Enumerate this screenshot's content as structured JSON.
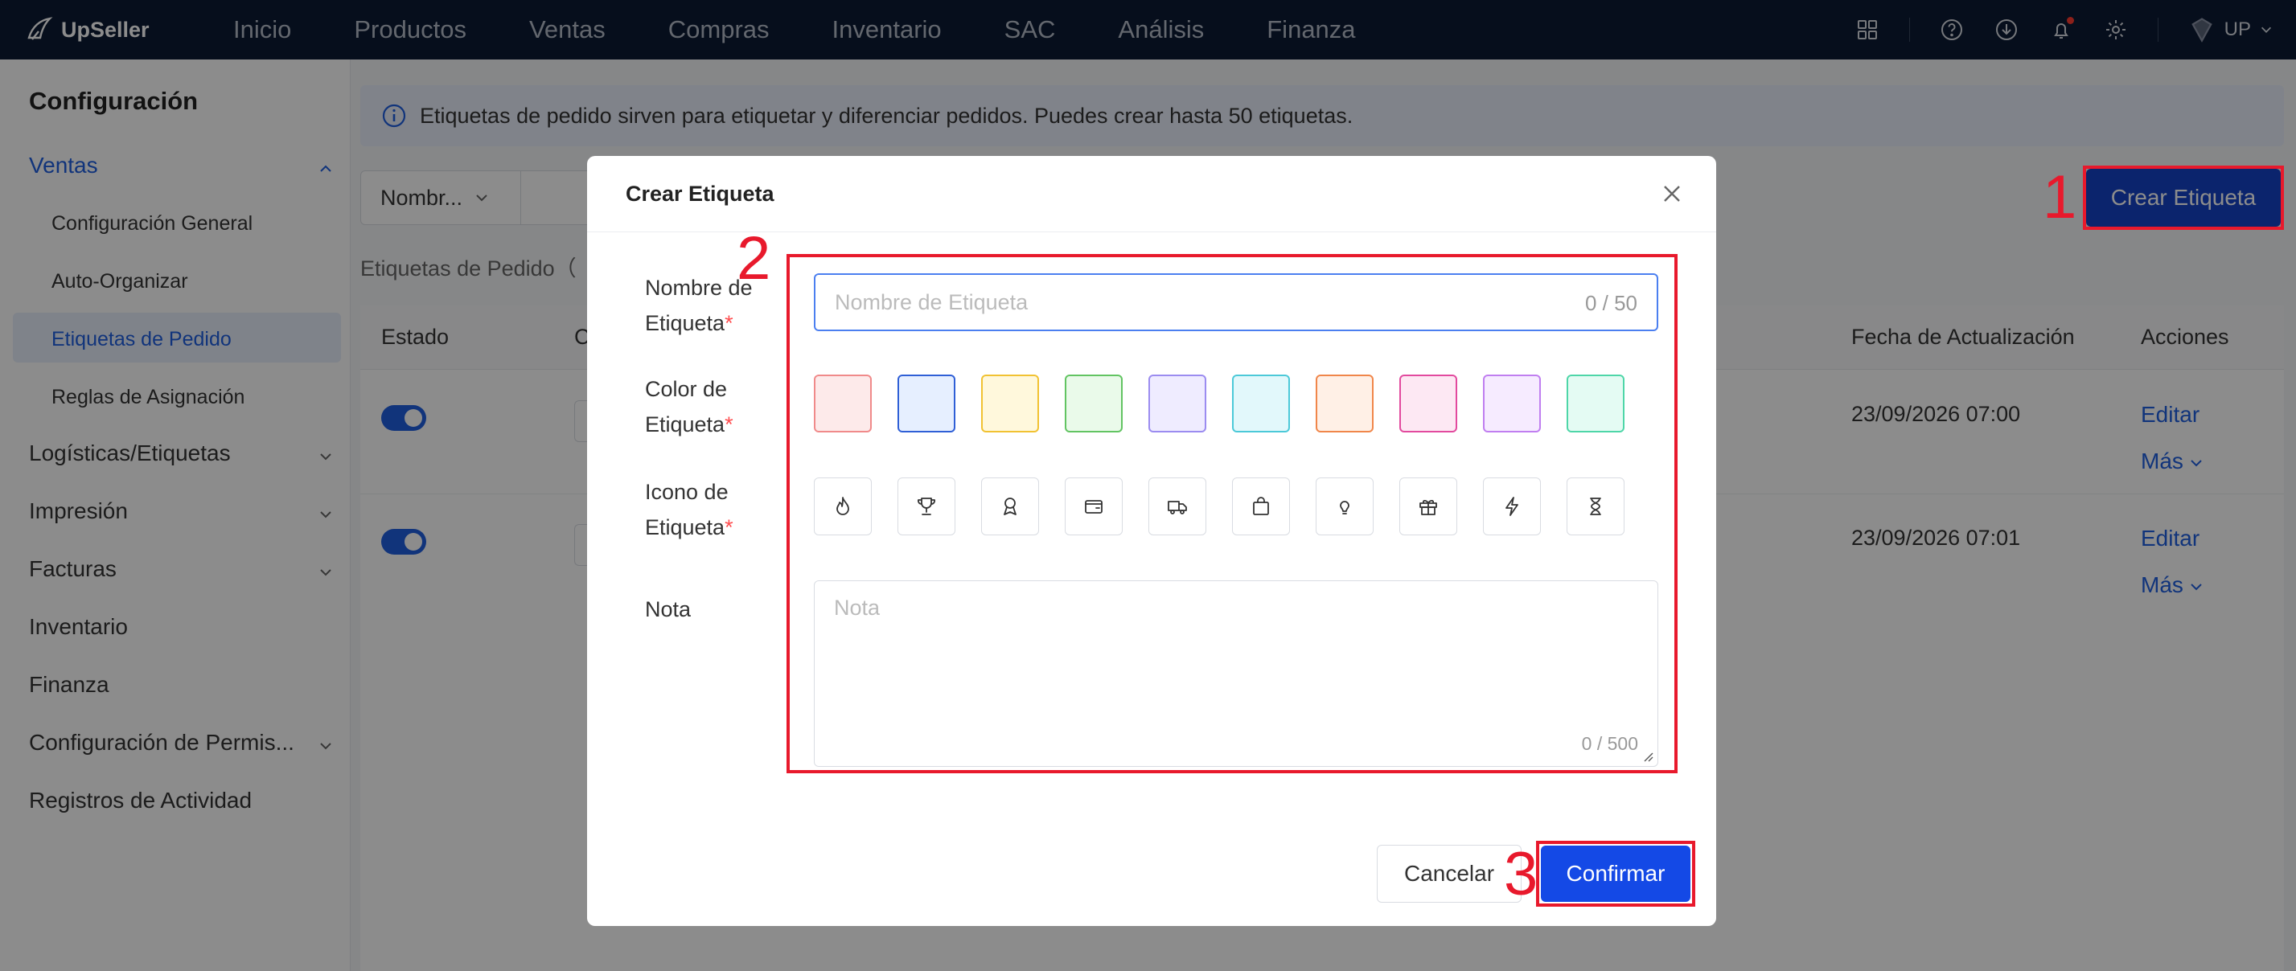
{
  "app": {
    "name": "UpSeller",
    "user": "UP"
  },
  "nav": [
    "Inicio",
    "Productos",
    "Ventas",
    "Compras",
    "Inventario",
    "SAC",
    "Análisis",
    "Finanza"
  ],
  "topbar_icons": [
    "apps-grid-icon",
    "help-icon",
    "download-icon",
    "bell-icon",
    "gear-icon",
    "avatar-icon",
    "chevron-down-icon"
  ],
  "sidebar": {
    "title": "Configuración",
    "ventas": "Ventas",
    "sub": [
      "Configuración General",
      "Auto-Organizar",
      "Etiquetas de Pedido",
      "Reglas de Asignación"
    ],
    "items": [
      "Logísticas/Etiquetas",
      "Impresión",
      "Facturas",
      "Inventario",
      "Finanza",
      "Configuración de Permis...",
      "Registros de Actividad"
    ]
  },
  "notice": "Etiquetas de pedido sirven para etiquetar y diferenciar pedidos. Puedes crear hasta 50 etiquetas.",
  "filter": {
    "select": "Nombr..."
  },
  "count_label": "Etiquetas de Pedido（",
  "create_button": "Crear Etiqueta",
  "table": {
    "headers": [
      "Estado",
      "C",
      "Fecha de Actualización",
      "Acciones"
    ],
    "rows": [
      {
        "date": "23/09/2026 07:00",
        "edit": "Editar",
        "more": "Más"
      },
      {
        "date": "23/09/2026 07:01",
        "edit": "Editar",
        "more": "Más"
      }
    ]
  },
  "modal": {
    "title": "Crear Etiqueta",
    "name_label": "Nombre de Etiqueta",
    "name_placeholder": "Nombre de Etiqueta",
    "name_count": "0 / 50",
    "color_label": "Color de Etiqueta",
    "colors": [
      {
        "bg": "#fdeaea",
        "border": "#f08a8a"
      },
      {
        "bg": "#e6efff",
        "border": "#2f5fd6"
      },
      {
        "bg": "#fff8dc",
        "border": "#f1c232"
      },
      {
        "bg": "#eafaea",
        "border": "#62c462"
      },
      {
        "bg": "#efecff",
        "border": "#9b8cf0"
      },
      {
        "bg": "#e2f8fb",
        "border": "#4cc9d8"
      },
      {
        "bg": "#fff0e6",
        "border": "#f0864a"
      },
      {
        "bg": "#fde8f3",
        "border": "#e24a9e"
      },
      {
        "bg": "#f6ebff",
        "border": "#c07ef0"
      },
      {
        "bg": "#e4fbf3",
        "border": "#4ed6a8"
      }
    ],
    "icon_label": "Icono de Etiqueta",
    "icons": [
      "flame-icon",
      "trophy-icon",
      "award-icon",
      "wallet-icon",
      "truck-icon",
      "shopping-bag-icon",
      "lightbulb-icon",
      "gift-icon",
      "lightning-icon",
      "hourglass-icon"
    ],
    "note_label": "Nota",
    "note_placeholder": "Nota",
    "note_count": "0 / 500",
    "cancel": "Cancelar",
    "confirm": "Confirmar"
  },
  "annotations": [
    "1",
    "2",
    "3"
  ],
  "annotation_color": "#e8192c",
  "accent_color": "#1f5fe0"
}
